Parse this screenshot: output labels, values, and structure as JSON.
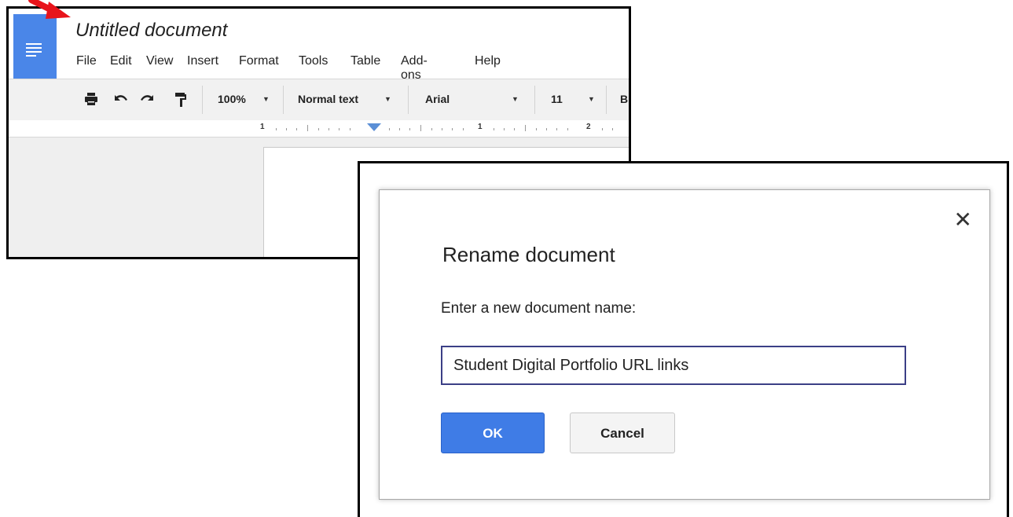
{
  "docs": {
    "title": "Untitled document",
    "menu": [
      "File",
      "Edit",
      "View",
      "Insert",
      "Format",
      "Tools",
      "Table",
      "Add-ons",
      "Help"
    ],
    "toolbar": {
      "print_icon": "print-icon",
      "undo_icon": "undo-icon",
      "redo_icon": "redo-icon",
      "paint_format_icon": "paint-format-icon",
      "zoom": "100%",
      "style": "Normal text",
      "font": "Arial",
      "font_size": "11",
      "bold": "B"
    },
    "ruler": {
      "labels": [
        "1",
        "1",
        "2"
      ]
    }
  },
  "dialog": {
    "title": "Rename document",
    "prompt": "Enter a new document name:",
    "input_value": "Student Digital Portfolio URL links",
    "ok_label": "OK",
    "cancel_label": "Cancel",
    "close_glyph": "✕"
  },
  "colors": {
    "docs_blue": "#4a86e8",
    "ok_blue": "#3f7ce6",
    "arrow_red": "#e8141b",
    "input_border": "#3b3f86"
  }
}
